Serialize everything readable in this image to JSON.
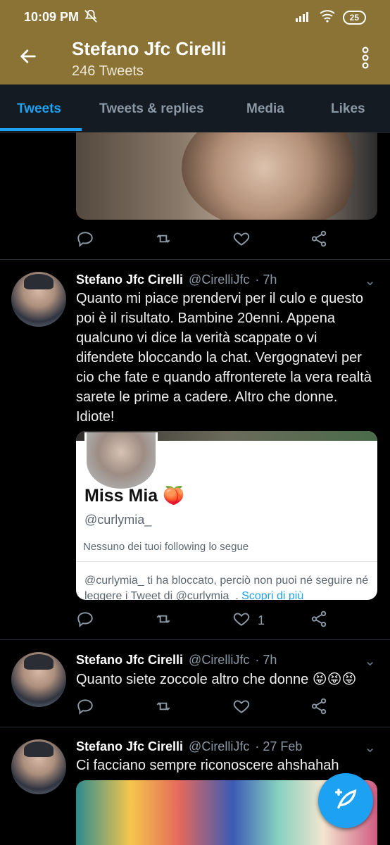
{
  "statusbar": {
    "time": "10:09 PM",
    "battery": "25",
    "icons": [
      "mute-icon",
      "signal-icon",
      "wifi-icon",
      "battery-icon"
    ]
  },
  "header": {
    "title": "Stefano Jfc Cirelli",
    "subtitle": "246 Tweets",
    "icons": [
      "back-arrow-icon",
      "more-vertical-icon"
    ]
  },
  "tabs": [
    {
      "label": "Tweets",
      "active": true
    },
    {
      "label": "Tweets & replies",
      "active": false
    },
    {
      "label": "Media",
      "active": false
    },
    {
      "label": "Likes",
      "active": false
    }
  ],
  "tweets": [
    {
      "name": "Stefano Jfc Cirelli",
      "handle": "@CirelliJfc",
      "time": "· 7h",
      "text": "Quanto mi piace prendervi per il culo e questo poi è il risultato. Bambine 20enni. Appena qualcuno vi dice la verità scappate o vi difendete bloccando la chat. Vergognatevi per cio che fate e quando affronterete la vera realtà sarete le prime a cadere. Altro che donne. Idiote!",
      "card": {
        "name": "Miss Mia 🍑",
        "handle": "@curlymia_",
        "note": "Nessuno dei tuoi following lo segue",
        "blocked": "@curlymia_ ti ha bloccato, perciò non puoi né seguire né leggere i Tweet di @curlymia_.",
        "link": "Scopri di più"
      },
      "likes": "1"
    },
    {
      "name": "Stefano Jfc Cirelli",
      "handle": "@CirelliJfc",
      "time": "· 7h",
      "text": "Quanto siete zoccole altro che donne 😝😝😝"
    },
    {
      "name": "Stefano Jfc Cirelli",
      "handle": "@CirelliJfc",
      "time": "· 27 Feb",
      "text": "Ci facciano sempre riconoscere ahshahah"
    }
  ],
  "colors": {
    "header": "#8a7335",
    "accent": "#1da1f2",
    "muted": "#8b98a5",
    "tabs_bg": "#141b22"
  }
}
